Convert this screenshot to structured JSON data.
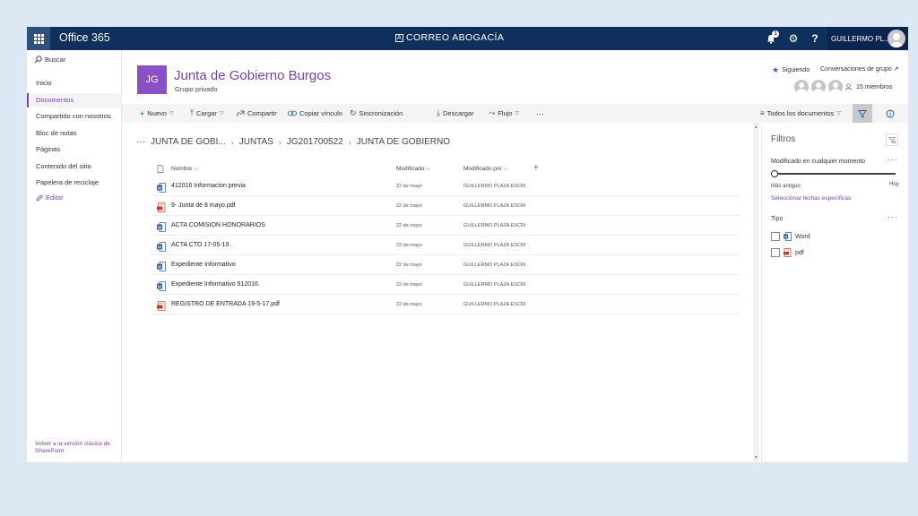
{
  "suite": {
    "title": "Office 365",
    "brand": "CORREO ABOGACÍA",
    "brand_mark": "A",
    "notification_count": "1",
    "user_name": "GUILLERMO PL...",
    "help_label": "?"
  },
  "nav": {
    "search_label": "Buscar",
    "items": [
      {
        "label": "Inicio"
      },
      {
        "label": "Documentos"
      },
      {
        "label": "Compartido con nosotros"
      },
      {
        "label": "Bloc de notas"
      },
      {
        "label": "Páginas"
      },
      {
        "label": "Contenido del sitio"
      },
      {
        "label": "Papelera de reciclaje"
      }
    ],
    "edit_label": "Editar",
    "classic_link": "Volver a la versión clásica de SharePoint"
  },
  "site": {
    "logo_text": "JG",
    "title": "Junta de Gobierno Burgos",
    "subtitle": "Grupo privado",
    "following_label": "Siguiendo",
    "conversations_label": "Conversaciones de grupo ↗",
    "members_label": "15 miembros"
  },
  "commands": {
    "new": "Nuevo",
    "upload": "Cargar",
    "share": "Compartir",
    "copy_link": "Copiar vínculo",
    "sync": "Sincronización",
    "download": "Descargar",
    "flow": "Flujo",
    "more": "···",
    "view": "Todos los documentos"
  },
  "breadcrumb": {
    "more": "···",
    "items": [
      "JUNTA DE GOBI...",
      "JUNTAS",
      "JG201700522",
      "JUNTA DE GOBIERNO"
    ]
  },
  "table": {
    "columns": {
      "name": "Nombre",
      "modified": "Modificado",
      "modified_by": "Modificado por",
      "add": "+"
    },
    "rows": [
      {
        "name": "412016 Informacion previa",
        "modified": "22 de mayo",
        "modified_by": "GUILLERMO PLAZA ESCRI",
        "type": "word"
      },
      {
        "name": "9- Junta de 8 mayo.pdf",
        "modified": "22 de mayo",
        "modified_by": "GUILLERMO PLAZA ESCRI",
        "type": "pdf"
      },
      {
        "name": "ACTA COMISION HONORARIOS",
        "modified": "22 de mayo",
        "modified_by": "GUILLERMO PLAZA ESCRI",
        "type": "word"
      },
      {
        "name": "ACTA CTO 17-05-19.",
        "modified": "22 de mayo",
        "modified_by": "GUILLERMO PLAZA ESCRI",
        "type": "word"
      },
      {
        "name": "Expediente Informativo",
        "modified": "22 de mayo",
        "modified_by": "GUILLERMO PLAZA ESCRI",
        "type": "word"
      },
      {
        "name": "Expediente Informativo 512016.",
        "modified": "22 de mayo",
        "modified_by": "GUILLERMO PLAZA ESCRI",
        "type": "word"
      },
      {
        "name": "REGISTRO DE ENTRADA 19-5-17.pdf",
        "modified": "22 de mayo",
        "modified_by": "GUILLERMO PLAZA ESCRI",
        "type": "pdf"
      }
    ]
  },
  "filters": {
    "title": "Filtros",
    "modified_label": "Modificado en cualquier momento",
    "oldest": "Más antiguo",
    "today": "Hoy",
    "select_dates": "Seleccionar fechas específicas",
    "type_label": "Tipo",
    "options": [
      {
        "label": "Word",
        "type": "word"
      },
      {
        "label": "pdf",
        "type": "pdf"
      }
    ]
  },
  "colors": {
    "suite_bar": "#0f2f5c",
    "accent": "#7b3fb5",
    "word": "#2b579a",
    "pdf": "#c43e1c"
  },
  "icons": [
    "waffle-icon",
    "bell-icon",
    "gear-icon",
    "search-icon",
    "pencil-icon",
    "star-icon",
    "filter-icon",
    "info-icon",
    "word-file-icon",
    "pdf-file-icon",
    "document-icon"
  ]
}
